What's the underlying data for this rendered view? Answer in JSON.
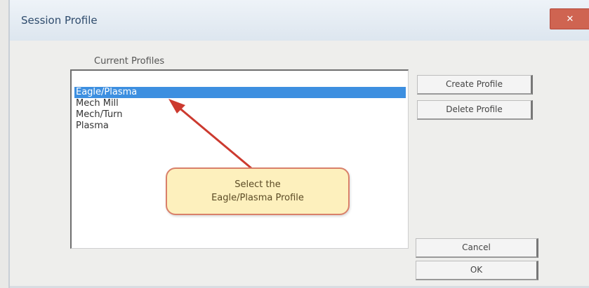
{
  "window": {
    "title": "Session Profile",
    "close_label": "✕"
  },
  "profiles": {
    "label": "Current Profiles",
    "items": [
      {
        "label": "Eagle/Plasma",
        "selected": true
      },
      {
        "label": "Mech Mill",
        "selected": false
      },
      {
        "label": "Mech/Turn",
        "selected": false
      },
      {
        "label": "Plasma",
        "selected": false
      }
    ]
  },
  "buttons": {
    "create": "Create Profile",
    "delete": "Delete Profile",
    "cancel": "Cancel",
    "ok": "OK"
  },
  "callout": {
    "line1": "Select the",
    "line2": "Eagle/Plasma Profile"
  },
  "colors": {
    "selection": "#3d8fe0",
    "callout_fill": "#fdf0bd",
    "callout_border": "#d9806a",
    "arrow": "#cc3a2f",
    "close_button": "#cf6451"
  }
}
